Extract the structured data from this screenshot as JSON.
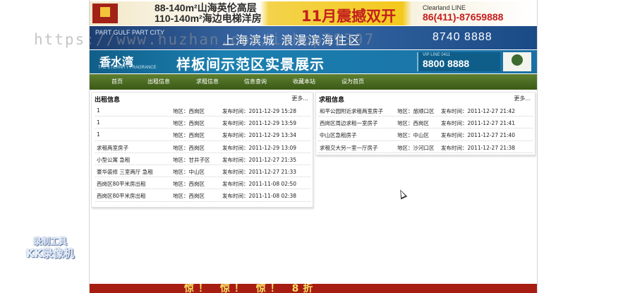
{
  "banners": {
    "top": {
      "line1": "88-140m²山海英伦高层",
      "line2": "110-140m²海边电梯洋房",
      "promo": "11月震撼双开",
      "brand": "Clearland LINE",
      "phone": "86(411)-87659888"
    },
    "middle": {
      "left_text": "PART GULF PART CITY",
      "title": "上海滨城 浪漫滨海住区",
      "phone": "8740 8888"
    },
    "bottom": {
      "brand": "香水湾",
      "brand_sub": "THE ETERNITY FRAGRANCE",
      "title": "样板间示范区实景展示",
      "hotline": "VIP LINE 0411",
      "phone": "8800 8888"
    }
  },
  "nav": [
    {
      "label": "首页"
    },
    {
      "label": "出租信息"
    },
    {
      "label": "求租信息"
    },
    {
      "label": "信息查询"
    },
    {
      "label": "收藏本站"
    },
    {
      "label": "设为首页"
    }
  ],
  "rent_panel": {
    "title": "出租信息",
    "more": "更多...",
    "rows": [
      {
        "title": "1",
        "area": "地区：西岗区",
        "date": "发布时间：2011-12-29 15:28"
      },
      {
        "title": "1",
        "area": "地区：西岗区",
        "date": "发布时间：2011-12-29 13:59"
      },
      {
        "title": "1",
        "area": "地区：西岗区",
        "date": "发布时间：2011-12-29 13:34"
      },
      {
        "title": "求租两室房子",
        "area": "地区：西岗区",
        "date": "发布时间：2011-12-29 13:09"
      },
      {
        "title": "小型公寓 急租",
        "area": "地区：甘井子区",
        "date": "发布时间：2011-12-27 21:35"
      },
      {
        "title": "豪华装修 三室两厅 急租",
        "area": "地区：中山区",
        "date": "发布时间：2011-12-27 21:33"
      },
      {
        "title": "西岗区80平米房出租",
        "area": "地区：西岗区",
        "date": "发布时间：2011-11-08 02:50"
      },
      {
        "title": "西岗区80平米房出租",
        "area": "地区：西岗区",
        "date": "发布时间：2011-11-08 02:38"
      }
    ]
  },
  "seek_panel": {
    "title": "求租信息",
    "more": "更多...",
    "rows": [
      {
        "title": "和平公园附近求租两室房子",
        "area": "地区：旅顺口区",
        "date": "发布时间：2011-12-27 21:42"
      },
      {
        "title": "西岗区周边求租一室房子",
        "area": "地区：西岗区",
        "date": "发布时间：2011-12-27 21:41"
      },
      {
        "title": "中山区急租房子",
        "area": "地区：中山区",
        "date": "发布时间：2011-12-27 21:40"
      },
      {
        "title": "求租交大另一室一厅房子",
        "area": "地区：沙河口区",
        "date": "发布时间：2011-12-27 21:38"
      }
    ]
  },
  "footer_banner": {
    "text": "惊！ 惊！ 惊！ 8折"
  },
  "overlays": {
    "url": "https://www.huzhan.com/ishop39397",
    "badge_line1": "录制工具",
    "badge_line2": "KK录像机"
  }
}
